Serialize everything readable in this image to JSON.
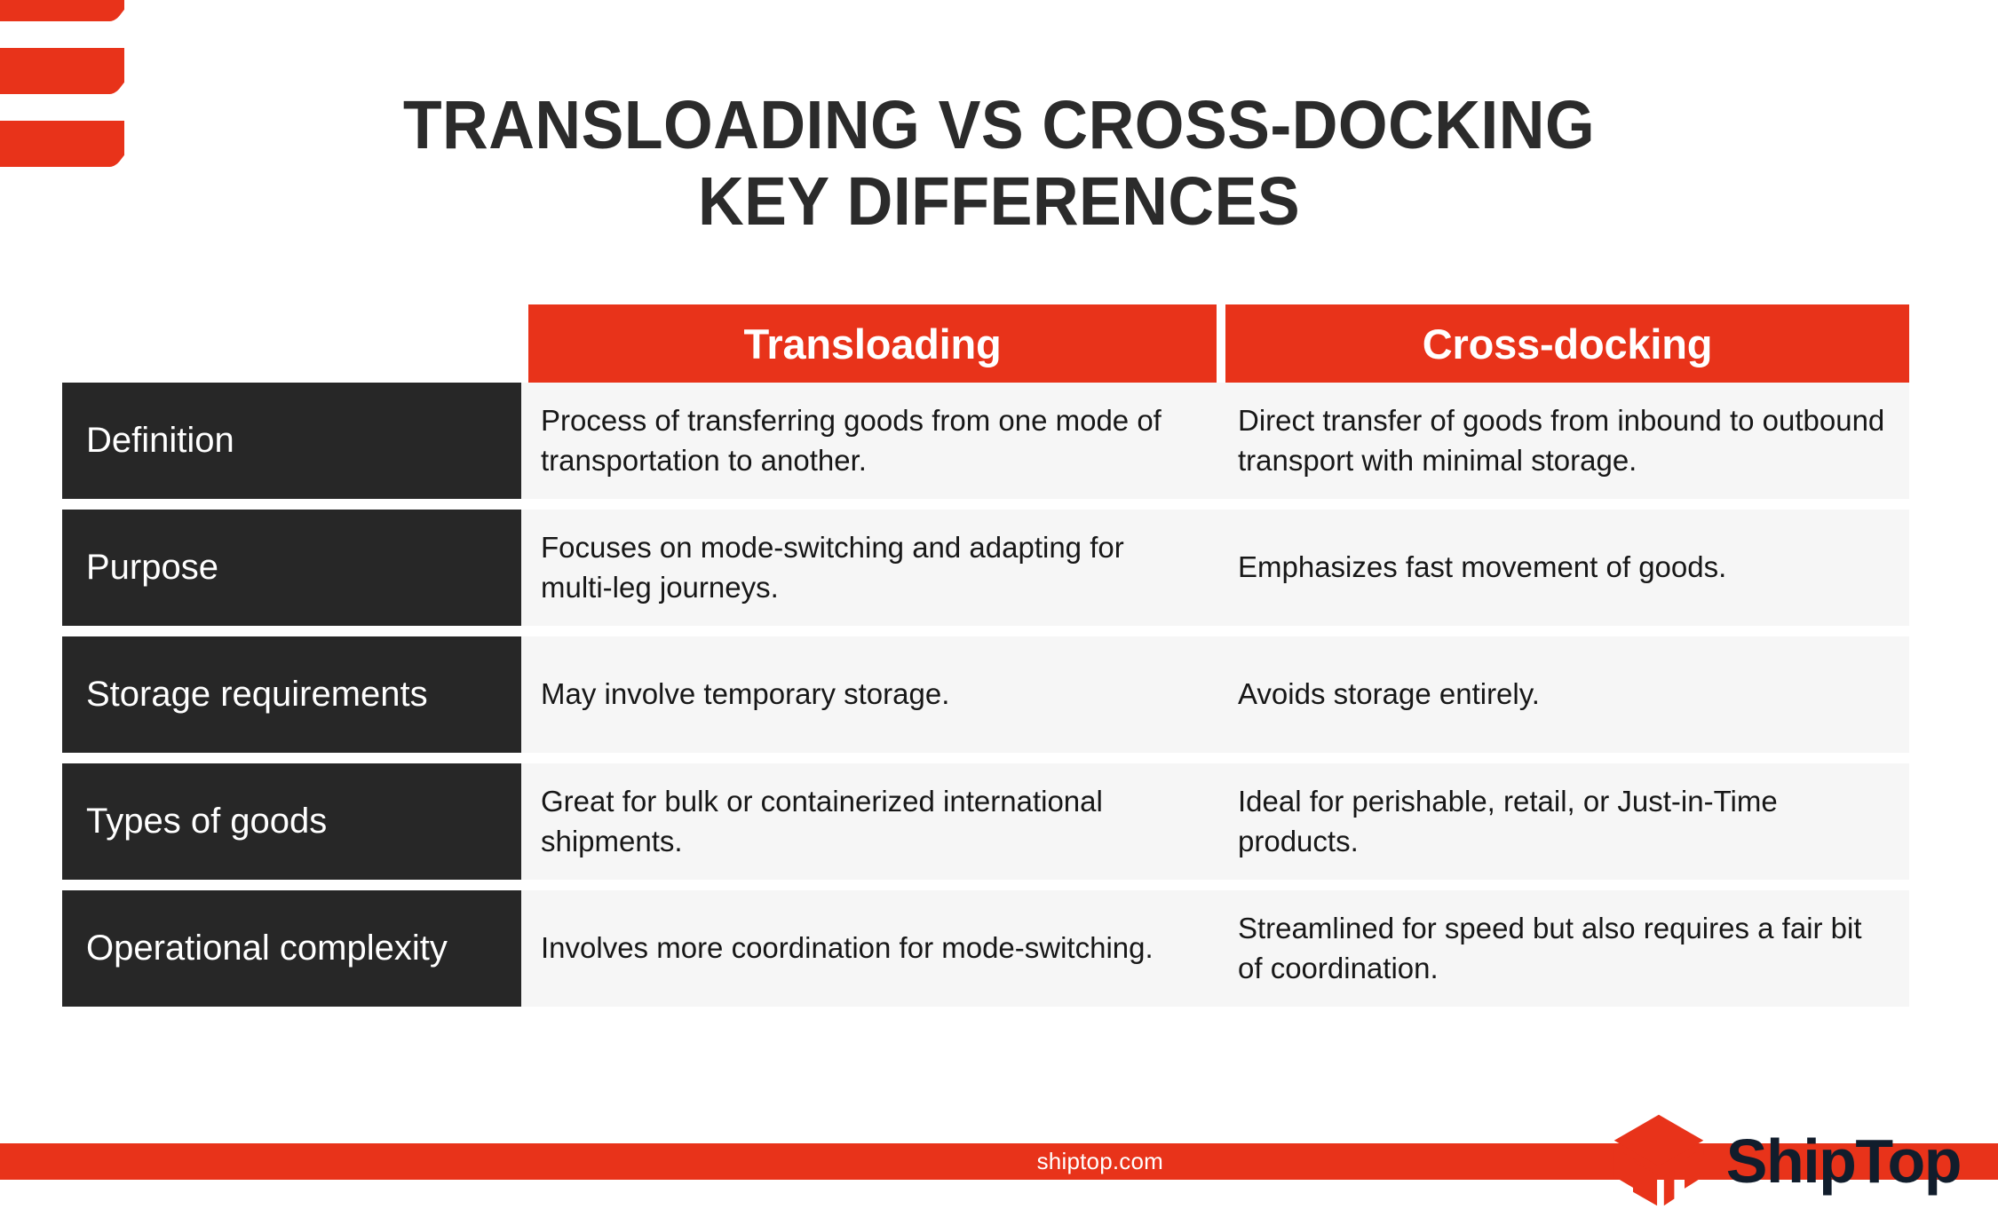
{
  "title": "TRANSLOADING VS CROSS-DOCKING\nKEY DIFFERENCES",
  "colors": {
    "accent_red": "#e8331a",
    "label_dark": "#272727",
    "row_bg": "#f6f6f6",
    "title_text": "#2b2b2b",
    "brand_navy": "#111d2c"
  },
  "table": {
    "columns": [
      {
        "label": "Transloading"
      },
      {
        "label": "Cross-docking"
      }
    ],
    "rows": [
      {
        "label": "Definition",
        "transloading": "Process of transferring goods from one mode of transportation to another.",
        "cross_docking": "Direct transfer of goods from inbound to outbound transport with minimal storage."
      },
      {
        "label": "Purpose",
        "transloading": "Focuses on mode-switching and adapting for multi-leg journeys.",
        "cross_docking": "Emphasizes fast movement of goods."
      },
      {
        "label": "Storage requirements",
        "transloading": "May involve temporary storage.",
        "cross_docking": "Avoids storage entirely."
      },
      {
        "label": "Types of goods",
        "transloading": "Great for bulk or containerized international shipments.",
        "cross_docking": "Ideal for perishable, retail, or Just-in-Time products."
      },
      {
        "label": "Operational complexity",
        "transloading": "Involves more coordination for mode-switching.",
        "cross_docking": "Streamlined for speed but also requires a fair bit of coordination."
      }
    ]
  },
  "footer": {
    "url": "shiptop.com",
    "brand_name": "ShipTop",
    "logo_icon": "shiptop-box-logo-icon"
  }
}
